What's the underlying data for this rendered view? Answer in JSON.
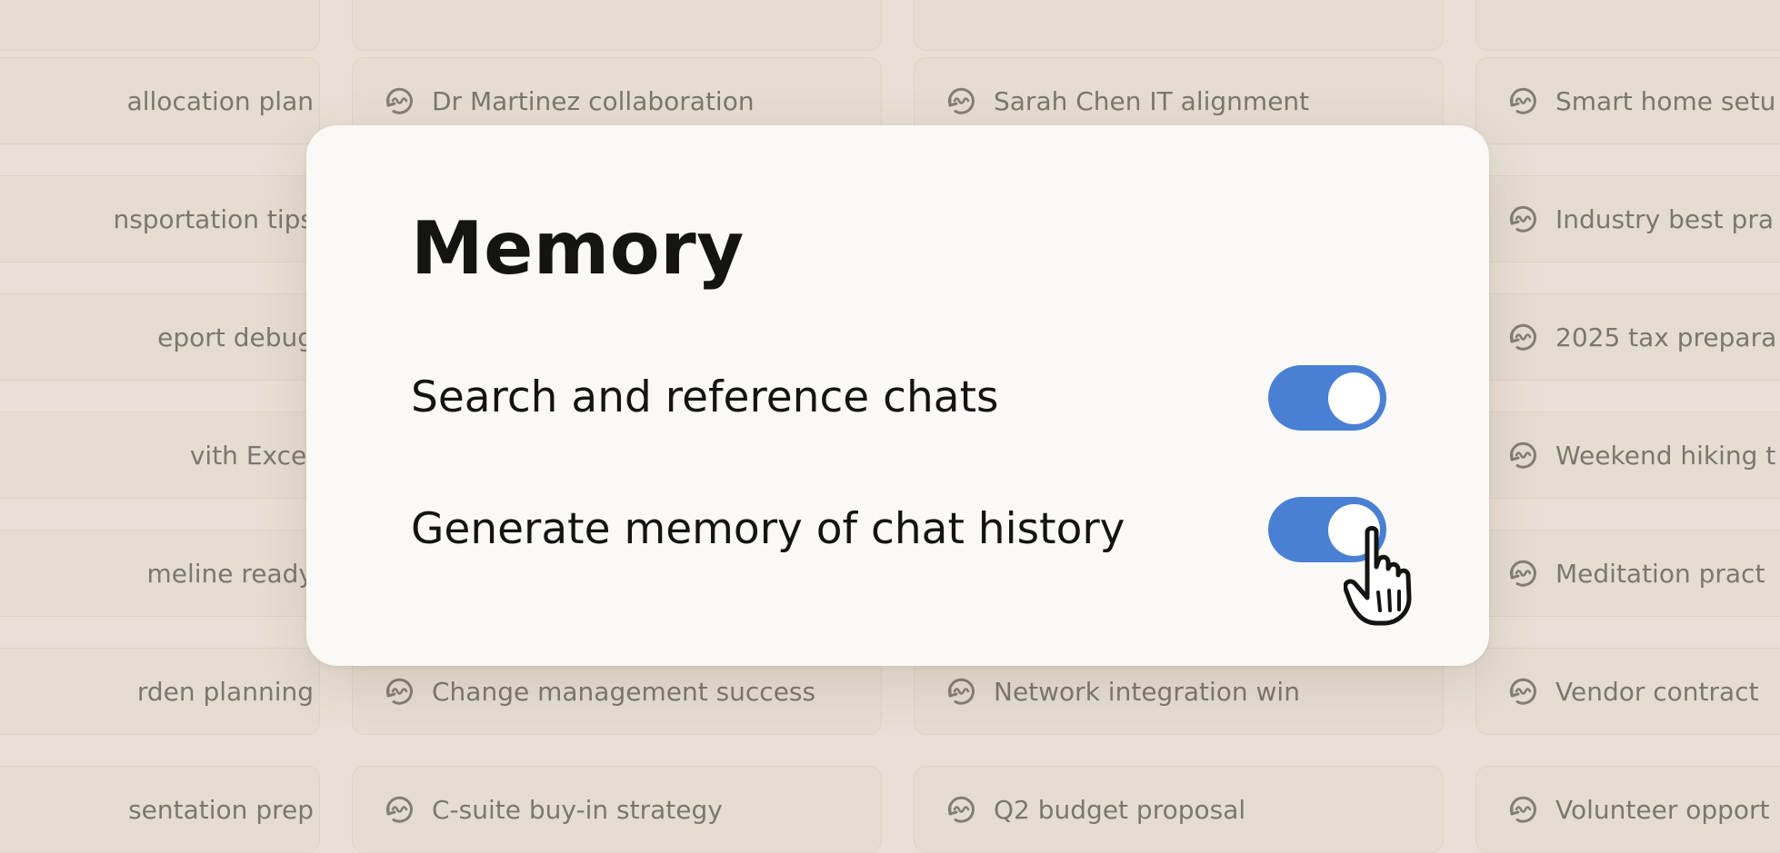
{
  "background_chats": [
    [
      "",
      "",
      "",
      ""
    ],
    [
      "allocation plan",
      "Dr Martinez collaboration",
      "Sarah Chen IT alignment",
      "Smart home setu"
    ],
    [
      "nsportation tips",
      "",
      "",
      "Industry best pra"
    ],
    [
      "eport debug",
      "",
      "",
      "2025 tax prepara"
    ],
    [
      "vith Excel",
      "",
      "",
      "Weekend hiking t"
    ],
    [
      "meline ready",
      "",
      "",
      "Meditation pract"
    ],
    [
      "rden planning",
      "Change management success",
      "Network integration win",
      "Vendor contract"
    ],
    [
      "sentation prep",
      "C-suite buy-in strategy",
      "Q2 budget proposal",
      "Volunteer opport"
    ]
  ],
  "modal": {
    "title": "Memory",
    "settings": [
      {
        "label": "Search and reference chats",
        "enabled": true
      },
      {
        "label": "Generate memory of chat history",
        "enabled": true
      }
    ]
  },
  "colors": {
    "accent": "#4a80d4",
    "background": "#e8e0d6",
    "card": "#e5ddd2",
    "modal": "#faf9f5",
    "text": "#141413",
    "muted_text": "#7d776f"
  },
  "icons": {
    "chat_item": "chat-history-icon",
    "cursor": "hand-pointer-icon"
  }
}
